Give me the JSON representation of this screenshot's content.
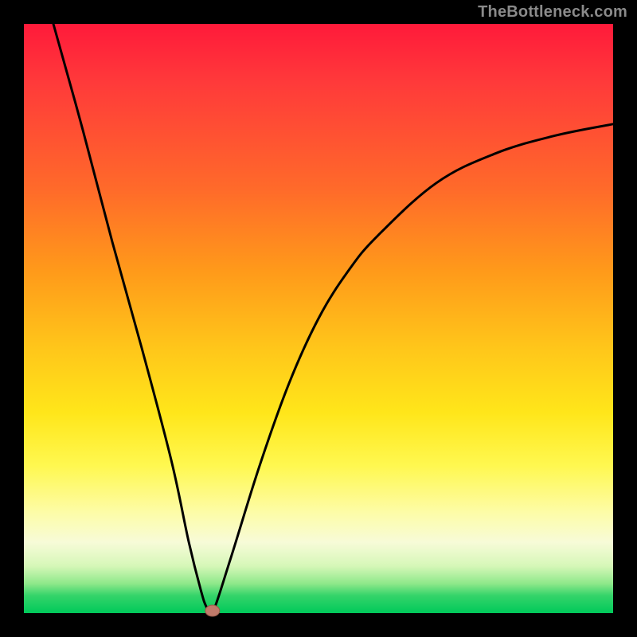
{
  "watermark": "TheBottleneck.com",
  "colors": {
    "frame": "#000000",
    "curve": "#000000",
    "marker_fill": "#c07a6a",
    "marker_stroke": "#9a5a4a"
  },
  "chart_data": {
    "type": "line",
    "title": "",
    "xlabel": "",
    "ylabel": "",
    "xlim": [
      0,
      100
    ],
    "ylim": [
      0,
      100
    ],
    "grid": false,
    "legend": false,
    "series": [
      {
        "name": "bottleneck-curve",
        "x": [
          5,
          10,
          15,
          20,
          25,
          28,
          30,
          31,
          32,
          35,
          40,
          45,
          50,
          55,
          60,
          70,
          80,
          90,
          100
        ],
        "y": [
          100,
          82,
          63,
          45,
          26,
          12,
          4,
          1,
          0,
          9,
          25,
          39,
          50,
          58,
          64,
          73,
          78,
          81,
          83
        ]
      }
    ],
    "annotations": [
      {
        "name": "min-marker",
        "x": 32,
        "y": 0
      }
    ]
  }
}
